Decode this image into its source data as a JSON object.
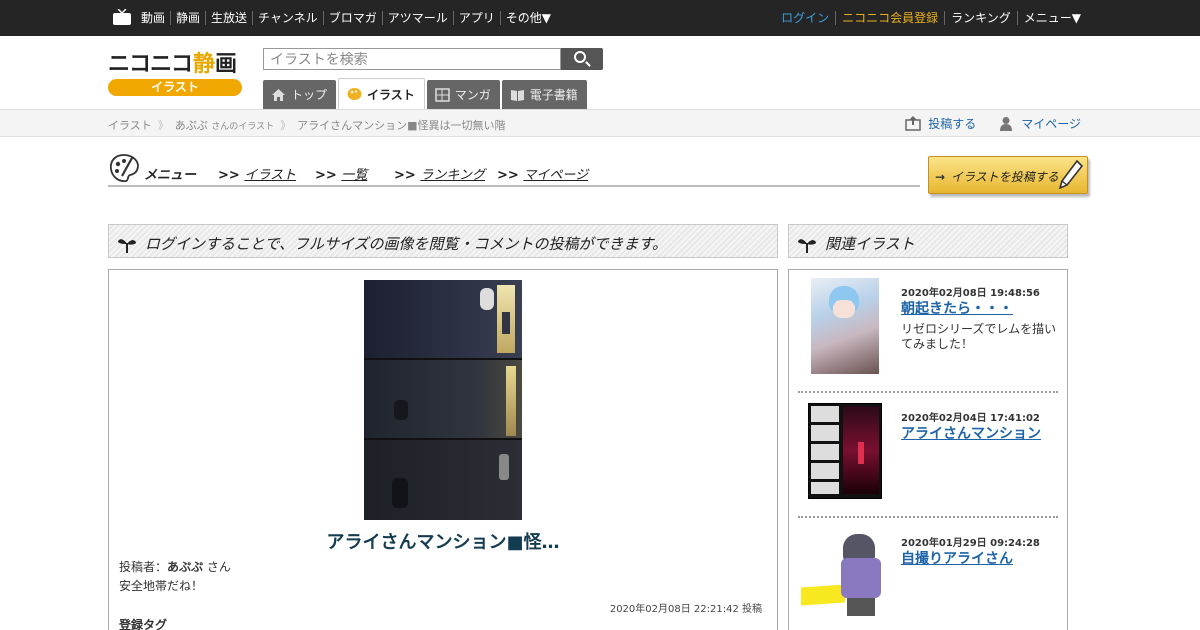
{
  "topbar": {
    "nav": [
      "動画",
      "静画",
      "生放送",
      "チャンネル",
      "ブロマガ",
      "アツマール",
      "アプリ",
      "その他▼"
    ],
    "right": {
      "login": "ログイン",
      "register": "ニコニコ会員登録",
      "ranking": "ランキング",
      "menu": "メニュー▼"
    }
  },
  "header": {
    "logo_main": "ニコニコ",
    "logo_sei": "静",
    "logo_ga": "画",
    "logo_sub": "イラスト",
    "search_placeholder": "イラストを検索",
    "tabs": [
      "トップ",
      "イラスト",
      "マンガ",
      "電子書籍"
    ]
  },
  "breadcrumb": {
    "items": [
      "イラスト",
      "あぷぷ",
      "アライさんマンション■怪異は一切無い階"
    ],
    "user_suffix": "さんのイラスト",
    "post": "投稿する",
    "mypage": "マイページ"
  },
  "menu": {
    "label": "メニュー",
    "prefix": ">>",
    "items": [
      "イラスト",
      "一覧",
      "ランキング",
      "マイページ"
    ],
    "post_button": "イラストを投稿する",
    "post_arrow": "→"
  },
  "main": {
    "notice": "ログインすることで、フルサイズの画像を閲覧・コメントの投稿ができます。",
    "title": "アライさんマンション■怪…",
    "poster_label": "投稿者：",
    "poster_name": "あぷぷ",
    "poster_suffix": " さん",
    "description": "安全地帯だね！",
    "posted_at": "2020年02月08日 22:21:42 投稿",
    "tags_label": "登録タグ"
  },
  "sidebar": {
    "heading": "関連イラスト",
    "items": [
      {
        "date": "2020年02月08日 19:48:56",
        "title": "朝起きたら・・・",
        "desc": "リゼロシリーズでレムを描いてみました！"
      },
      {
        "date": "2020年02月04日 17:41:02",
        "title": "アライさんマンション",
        "desc": ""
      },
      {
        "date": "2020年01月29日 09:24:28",
        "title": "自撮りアライさん",
        "desc": ""
      }
    ]
  },
  "colors": {
    "accent_blue": "#1e63a8",
    "logo_orange": "#f0a800",
    "topbar": "#252525",
    "title_dark": "#143c50"
  }
}
